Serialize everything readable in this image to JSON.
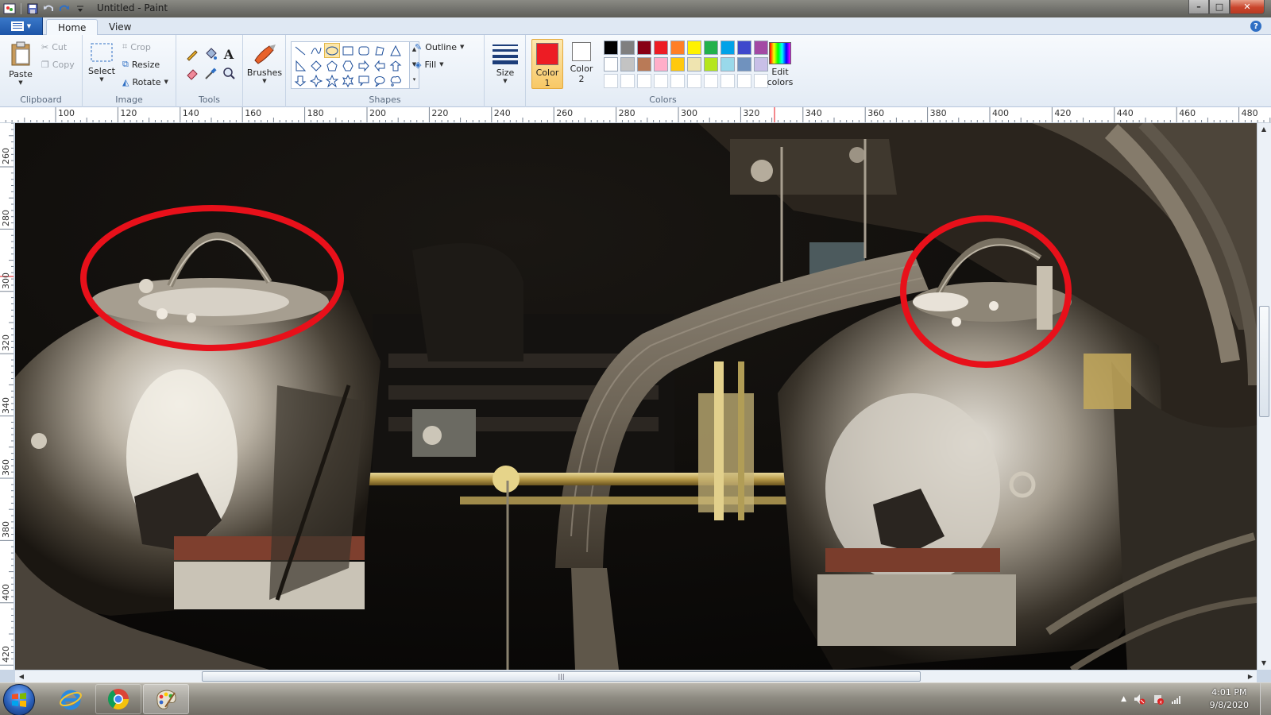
{
  "window": {
    "title": "Untitled - Paint",
    "buttons": {
      "minimize": "–",
      "maximize": "□",
      "close": "✕"
    }
  },
  "tabs": [
    {
      "label": "Home",
      "active": true
    },
    {
      "label": "View",
      "active": false
    }
  ],
  "help_label": "?",
  "ribbon": {
    "clipboard": {
      "label": "Clipboard",
      "paste": "Paste",
      "cut": "Cut",
      "copy": "Copy"
    },
    "image": {
      "label": "Image",
      "select": "Select",
      "crop": "Crop",
      "resize": "Resize",
      "rotate": "Rotate"
    },
    "tools": {
      "label": "Tools"
    },
    "brushes": {
      "label": "Brushes"
    },
    "shapes": {
      "label": "Shapes",
      "outline": "Outline",
      "fill": "Fill"
    },
    "size": {
      "label": "Size"
    },
    "colors": {
      "label": "Colors",
      "color1_line1": "Color",
      "color1_line2": "1",
      "color1_value": "#ed1c24",
      "color2_line1": "Color",
      "color2_line2": "2",
      "color2_value": "#ffffff",
      "edit_line1": "Edit",
      "edit_line2": "colors",
      "palette_row1": [
        "#000000",
        "#7f7f7f",
        "#880015",
        "#ed1c24",
        "#ff7f27",
        "#fff200",
        "#22b14c",
        "#00a2e8",
        "#3f48cc",
        "#a349a4"
      ],
      "palette_row2": [
        "#ffffff",
        "#c3c3c3",
        "#b97a57",
        "#ffaec9",
        "#ffc90e",
        "#efe4b0",
        "#b5e61d",
        "#99d9ea",
        "#7092be",
        "#c8bfe7"
      ],
      "palette_row3": [
        "#ffffff",
        "#ffffff",
        "#ffffff",
        "#ffffff",
        "#ffffff",
        "#ffffff",
        "#ffffff",
        "#ffffff",
        "#ffffff",
        "#ffffff"
      ]
    }
  },
  "ruler_top": [
    "100",
    "120",
    "140",
    "160",
    "180",
    "200",
    "220",
    "240",
    "260",
    "280",
    "300",
    "320",
    "340",
    "360",
    "380",
    "400",
    "420",
    "440",
    "460",
    "480"
  ],
  "ruler_left": [
    "260",
    "280",
    "300",
    "320",
    "340",
    "360",
    "380",
    "400",
    "420"
  ],
  "canvas": {
    "photo": "engine carburetors close-up",
    "annotation_color": "#e8101a"
  },
  "hscroll_grip": "|||",
  "taskbar": {
    "apps": [
      "internet-explorer",
      "chrome",
      "paint"
    ],
    "clock_time": "4:01 PM",
    "clock_date": "9/8/2020"
  }
}
